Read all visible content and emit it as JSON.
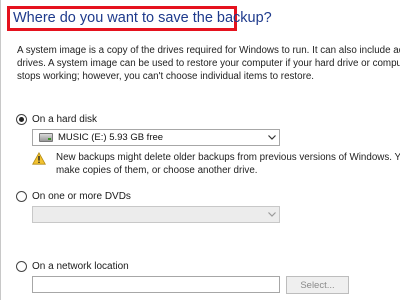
{
  "heading": "Where do you want to save the backup?",
  "description": [
    "A system image is a copy of the drives required for Windows to run. It can also include addit",
    "drives. A system image can be used to restore your computer if your hard drive or computer",
    "stops working; however, you can't choose individual items to restore."
  ],
  "options": {
    "hard_disk": {
      "label": "On a hard disk",
      "selected": true,
      "drive_value": "MUSIC (E:)  5.93 GB free",
      "drive_icon": "drive-icon",
      "warning_icon": "warning-icon",
      "warning_lines": [
        "New backups might delete older backups from previous versions of Windows. You",
        "make copies of them, or choose another drive."
      ]
    },
    "dvds": {
      "label": "On one or more DVDs",
      "selected": false,
      "drive_value": ""
    },
    "network": {
      "label": "On a network location",
      "selected": false,
      "location_value": "",
      "select_button": "Select..."
    }
  },
  "colors": {
    "heading_text": "#1e3a8c",
    "highlight_border": "#e5121e"
  }
}
